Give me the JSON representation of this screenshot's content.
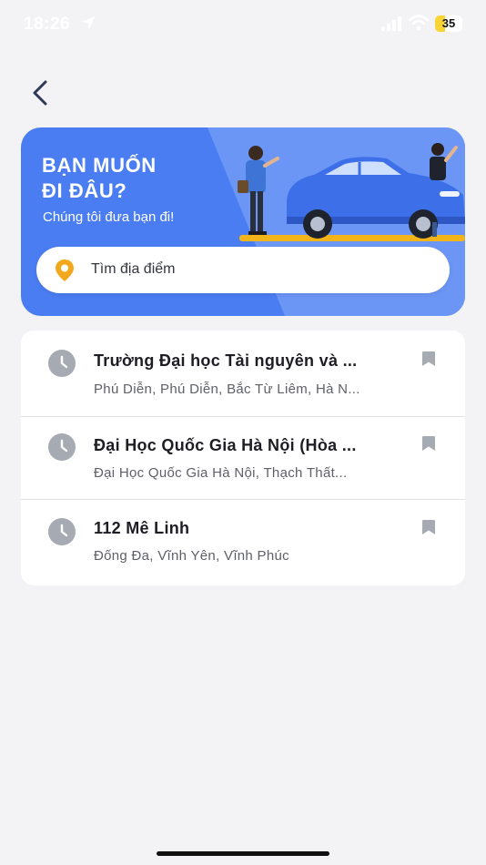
{
  "status_bar": {
    "time": "18:26",
    "battery": "35",
    "battery_level": 0.35
  },
  "header": {
    "back_icon": "chevron-left-icon"
  },
  "hero": {
    "title": "BẠN MUỐN\nĐI ĐÂU?",
    "subtitle": "Chúng tôi đưa bạn đi!",
    "colors": {
      "background": "#4b7df2",
      "light_panel": "#6c96f5",
      "road": "#f2b418"
    }
  },
  "search": {
    "placeholder": "Tìm địa điểm",
    "icon": "location-pin-icon",
    "pin_color": "#f2a81d"
  },
  "recent_places": [
    {
      "title": "Trường Đại học Tài nguyên và ...",
      "subtitle": "Phú Diễn, Phú Diễn, Bắc Từ Liêm, Hà N..."
    },
    {
      "title": "Đại Học Quốc Gia Hà Nội (Hòa ...",
      "subtitle": "Đại Học Quốc Gia Hà Nội, Thạch Thất..."
    },
    {
      "title": "112 Mê Linh",
      "subtitle": "Đống Đa, Vĩnh Yên, Vĩnh Phúc"
    }
  ]
}
